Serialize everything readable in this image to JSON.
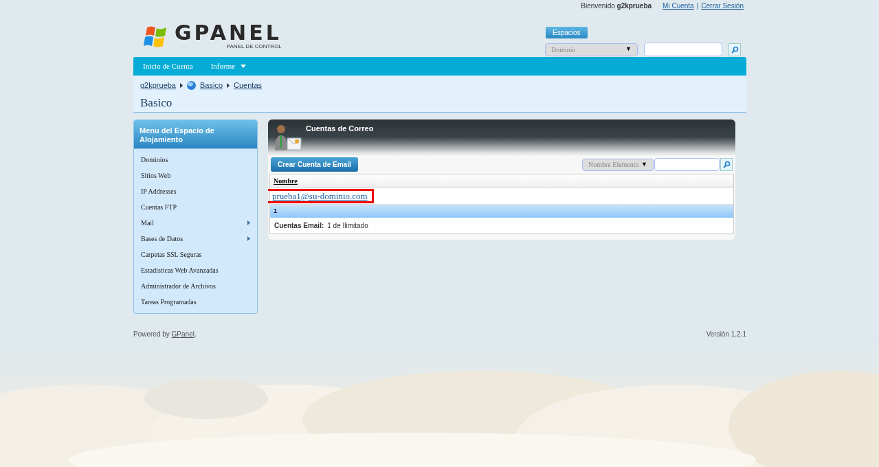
{
  "header": {
    "welcome": "Bienvenido",
    "user": "g2kprueba",
    "links": [
      {
        "label": "Mi Cuenta"
      },
      {
        "label": "Cerrar Sesión"
      }
    ],
    "separator": "|",
    "logo": {
      "word": "GPANEL",
      "tagline": "PANEL DE CONTROL"
    },
    "spaces": {
      "label": "Espacios",
      "select": "Dominio",
      "arrow": "▼"
    }
  },
  "nav": [
    {
      "label": "Inicio de Cuenta",
      "dropdown": false
    },
    {
      "label": "Informe",
      "dropdown": true
    }
  ],
  "breadcrumb": [
    {
      "label": "g2kprueba",
      "globe": false
    },
    {
      "label": "Basico",
      "globe": true
    },
    {
      "label": "Cuentas",
      "globe": false
    }
  ],
  "page_title": "Basico",
  "sidebar": {
    "title": "Menu del Espacio de Alojamiento",
    "items": [
      {
        "label": "Dominios",
        "submenu": false
      },
      {
        "label": "Sitios Web",
        "submenu": false
      },
      {
        "label": "IP Addresses",
        "submenu": false
      },
      {
        "label": "Cuentas FTP",
        "submenu": false
      },
      {
        "label": "Mail",
        "submenu": true
      },
      {
        "label": "Bases de Datos",
        "submenu": true
      },
      {
        "label": "Carpetas SSL Seguras",
        "submenu": false
      },
      {
        "label": "Estadisticas Web Avanzadas",
        "submenu": false
      },
      {
        "label": "Administrador de Archivos",
        "submenu": false
      },
      {
        "label": "Tareas Programadas",
        "submenu": false
      }
    ]
  },
  "panel": {
    "title": "Cuentas de Correo",
    "create_button": "Crear Cuenta de Email",
    "filter": {
      "select": "Nombre Elemento",
      "arrow": "▼"
    },
    "table": {
      "columns": [
        "Nombre"
      ],
      "rows": [
        {
          "cells": [
            "prueba1@su-dominio.com"
          ],
          "highlighted": true
        }
      ]
    },
    "pager": [
      "1"
    ],
    "summary": {
      "label": "Cuentas Email:",
      "value": "1 de Ilimitado"
    }
  },
  "footer": {
    "powered": "Powered by",
    "link": "GPanel",
    "period": ".",
    "version": "Versión 1.2.1"
  }
}
